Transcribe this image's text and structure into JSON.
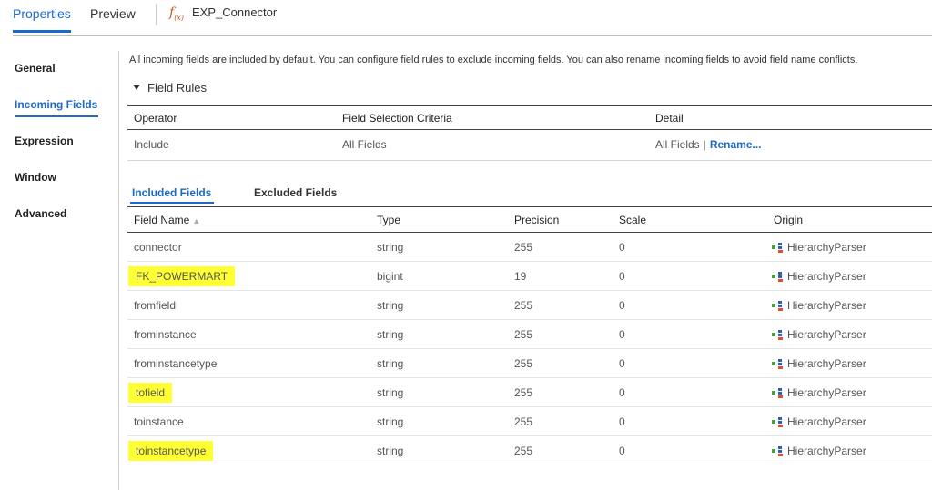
{
  "topbar": {
    "tab_properties": "Properties",
    "tab_preview": "Preview",
    "transformation_name": "EXP_Connector"
  },
  "leftnav": {
    "items": [
      {
        "label": "General"
      },
      {
        "label": "Incoming Fields",
        "active": true
      },
      {
        "label": "Expression"
      },
      {
        "label": "Window"
      },
      {
        "label": "Advanced"
      }
    ]
  },
  "main": {
    "info_text": "All incoming fields are included by default. You can configure field rules to exclude incoming fields. You can also rename incoming fields to avoid field name conflicts.",
    "field_rules_label": "Field Rules",
    "rules_headers": {
      "operator": "Operator",
      "criteria": "Field Selection Criteria",
      "detail": "Detail"
    },
    "rules_row": {
      "operator": "Include",
      "criteria": "All Fields",
      "detail": "All Fields",
      "separator": "|",
      "rename_link": "Rename..."
    },
    "subtabs": {
      "included": "Included Fields",
      "excluded": "Excluded Fields"
    },
    "fields_headers": {
      "name": "Field Name",
      "type": "Type",
      "precision": "Precision",
      "scale": "Scale",
      "origin": "Origin"
    },
    "sort_indicator": "▲",
    "rows": [
      {
        "name": "connector",
        "type": "string",
        "precision": "255",
        "scale": "0",
        "origin": "HierarchyParser",
        "highlighted": false
      },
      {
        "name": "FK_POWERMART",
        "type": "bigint",
        "precision": "19",
        "scale": "0",
        "origin": "HierarchyParser",
        "highlighted": true
      },
      {
        "name": "fromfield",
        "type": "string",
        "precision": "255",
        "scale": "0",
        "origin": "HierarchyParser",
        "highlighted": false
      },
      {
        "name": "frominstance",
        "type": "string",
        "precision": "255",
        "scale": "0",
        "origin": "HierarchyParser",
        "highlighted": false
      },
      {
        "name": "frominstancetype",
        "type": "string",
        "precision": "255",
        "scale": "0",
        "origin": "HierarchyParser",
        "highlighted": false
      },
      {
        "name": "tofield",
        "type": "string",
        "precision": "255",
        "scale": "0",
        "origin": "HierarchyParser",
        "highlighted": true
      },
      {
        "name": "toinstance",
        "type": "string",
        "precision": "255",
        "scale": "0",
        "origin": "HierarchyParser",
        "highlighted": false
      },
      {
        "name": "toinstancetype",
        "type": "string",
        "precision": "255",
        "scale": "0",
        "origin": "HierarchyParser",
        "highlighted": true
      }
    ]
  },
  "colors": {
    "accent": "#1b6ac9",
    "highlight": "#ffff33",
    "expression_icon": "#d2561d"
  },
  "icons": {
    "expression": "fx-expression-icon",
    "origin": "hierarchy-parser-icon",
    "collapse": "triangle-down-icon"
  }
}
